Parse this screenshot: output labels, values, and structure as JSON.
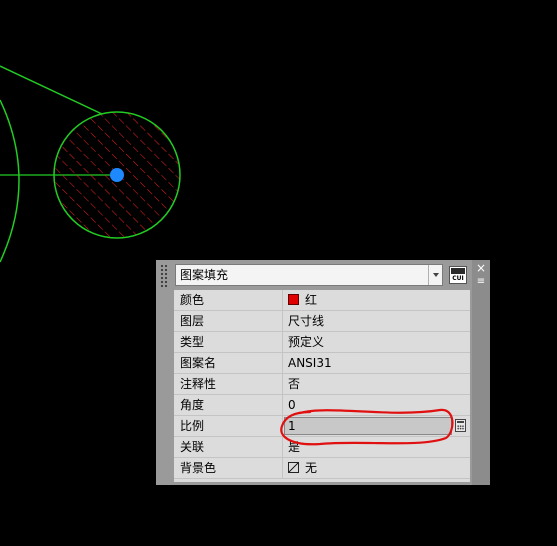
{
  "palette": {
    "object_type": "图案填充",
    "cui_label": "CUI",
    "close_glyph": "×",
    "menu_glyph": "≡",
    "properties": [
      {
        "name": "颜色",
        "value": "红",
        "kind": "color",
        "color": "#e00000"
      },
      {
        "name": "图层",
        "value": "尺寸线",
        "kind": "text"
      },
      {
        "name": "类型",
        "value": "预定义",
        "kind": "text"
      },
      {
        "name": "图案名",
        "value": "ANSI31",
        "kind": "text"
      },
      {
        "name": "注释性",
        "value": "否",
        "kind": "text"
      },
      {
        "name": "角度",
        "value": "0",
        "kind": "text"
      },
      {
        "name": "比例",
        "value": "1",
        "kind": "edit"
      },
      {
        "name": "关联",
        "value": "是",
        "kind": "text"
      },
      {
        "name": "背景色",
        "value": "无",
        "kind": "bgcolor"
      }
    ]
  },
  "drawing": {
    "background": "#000000",
    "geometry_color": "#22cc22",
    "hatch_color": "#e02020",
    "grip_color": "#1e88ff",
    "annotation_color": "#e01010"
  }
}
